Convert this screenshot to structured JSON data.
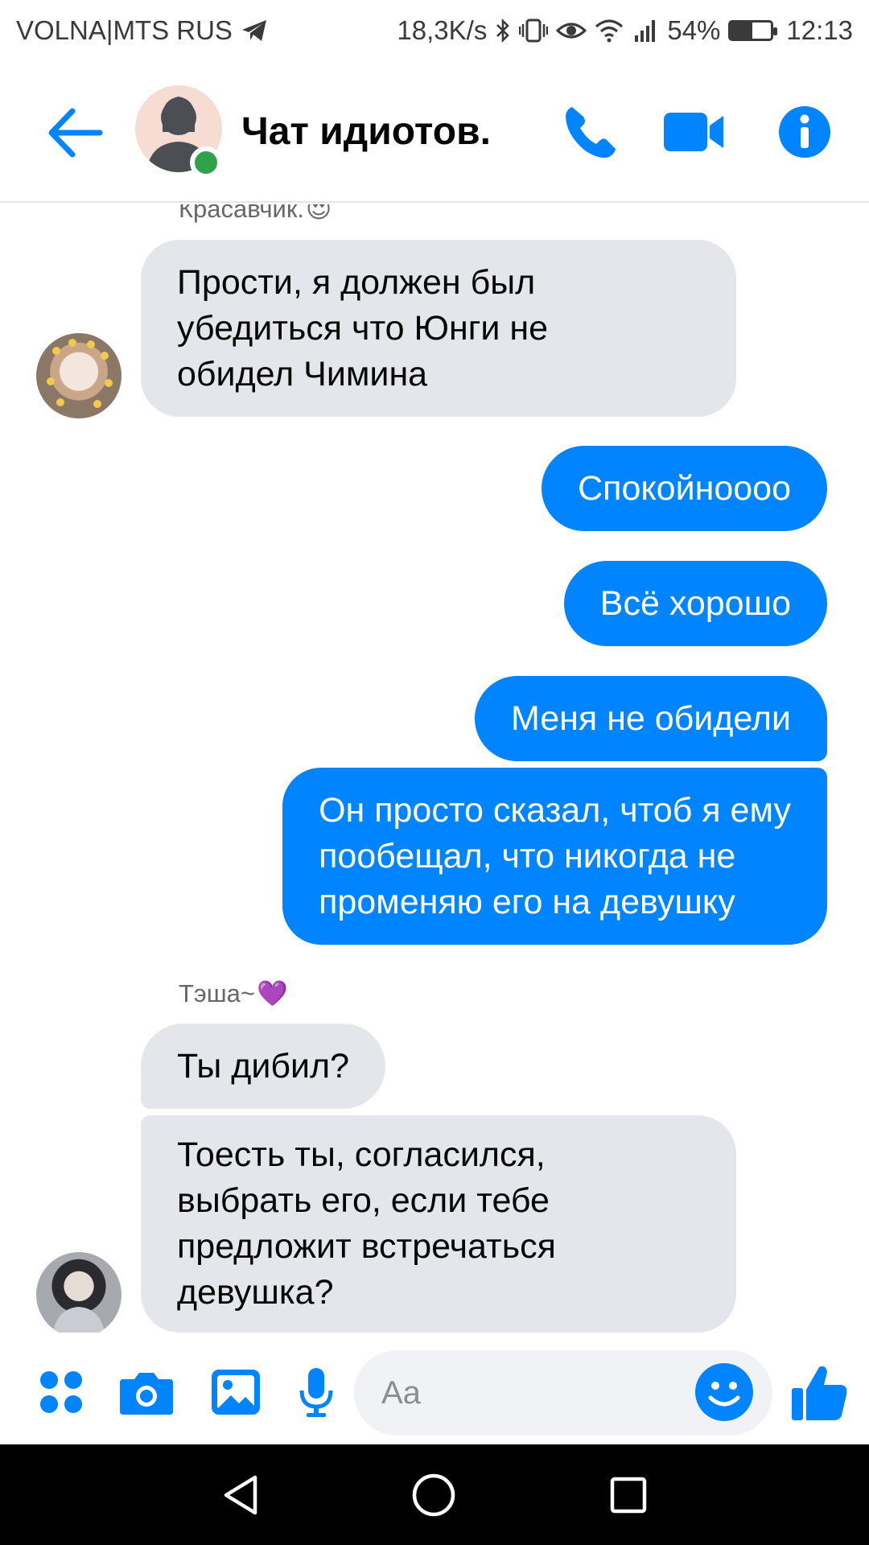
{
  "status_bar": {
    "carrier": "VOLNA|MTS RUS",
    "speed": "18,3K/s",
    "battery": "54%",
    "battery_level": 0.54,
    "time": "12:13"
  },
  "header": {
    "title": "Чат идиотов.",
    "icons": [
      "back-arrow-icon",
      "phone-icon",
      "video-camera-icon",
      "info-icon"
    ]
  },
  "messages": [
    {
      "type": "sender",
      "name": "Красавчик.",
      "emoji": "😍"
    },
    {
      "type": "incoming",
      "text": "Прости, я должен был\nубедиться что Юнги не\nобидел Чимина"
    },
    {
      "type": "outgoing",
      "text": "Спокойнооoo"
    },
    {
      "type": "outgoing",
      "text": "Всё хорошо"
    },
    {
      "type": "outgoing",
      "text": "Меня не обидели"
    },
    {
      "type": "outgoing",
      "text": "Он просто сказал, чтоб я ему\nпообещал, что никогда не\nпроменяю его на девушку"
    },
    {
      "type": "sender",
      "name": "Тэша~",
      "emoji": "💜"
    },
    {
      "type": "incoming",
      "text": "Ты дибил?"
    },
    {
      "type": "incoming",
      "text": "Тоесть ты, согласился,\nвыбрать его, если тебе\nпредложит встречаться\nдевушка?"
    }
  ],
  "composer": {
    "placeholder": "Aa",
    "icons": [
      "menu-dots-icon",
      "camera-icon",
      "gallery-icon",
      "microphone-icon",
      "emoji-icon",
      "thumbs-up-icon"
    ]
  },
  "colors": {
    "accent": "#0084ff",
    "incoming_bubble": "#e4e6eb",
    "online": "#31a24c"
  }
}
